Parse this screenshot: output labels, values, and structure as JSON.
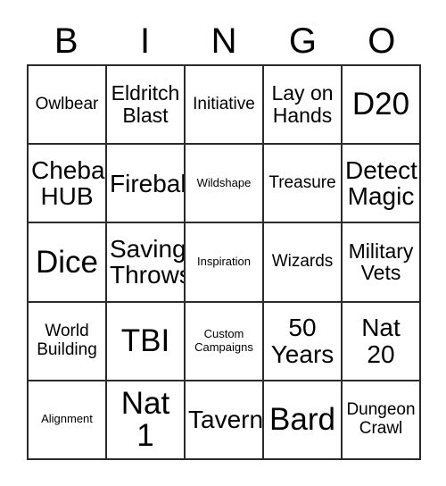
{
  "card": {
    "header_letters": [
      "B",
      "I",
      "N",
      "G",
      "O"
    ],
    "columns": 5,
    "rows": 5,
    "border_color": "#2b2b2b",
    "background_color": "#ffffff",
    "text_color": "#000000",
    "cells": [
      {
        "text": "Owlbear",
        "size": "md"
      },
      {
        "text": "Eldritch\nBlast",
        "size": "lg"
      },
      {
        "text": "Initiative",
        "size": "md"
      },
      {
        "text": "Lay on\nHands",
        "size": "lg"
      },
      {
        "text": "D20",
        "size": "xxl"
      },
      {
        "text": "Cheba\nHUB",
        "size": "xl"
      },
      {
        "text": "Fireball",
        "size": "xl"
      },
      {
        "text": "Wildshape",
        "size": "xs"
      },
      {
        "text": "Treasure",
        "size": "md"
      },
      {
        "text": "Detect\nMagic",
        "size": "xl"
      },
      {
        "text": "Dice",
        "size": "xxl"
      },
      {
        "text": "Saving\nThrows",
        "size": "xl"
      },
      {
        "text": "Inspiration",
        "size": "xs"
      },
      {
        "text": "Wizards",
        "size": "md"
      },
      {
        "text": "Military\nVets",
        "size": "lg"
      },
      {
        "text": "World\nBuilding",
        "size": "md"
      },
      {
        "text": "TBI",
        "size": "xxl"
      },
      {
        "text": "Custom\nCampaigns",
        "size": "xs"
      },
      {
        "text": "50\nYears",
        "size": "xl"
      },
      {
        "text": "Nat\n20",
        "size": "xl"
      },
      {
        "text": "Alignment",
        "size": "xs"
      },
      {
        "text": "Nat\n1",
        "size": "xxl"
      },
      {
        "text": "Tavern",
        "size": "xl"
      },
      {
        "text": "Bard",
        "size": "xxl"
      },
      {
        "text": "Dungeon\nCrawl",
        "size": "md"
      }
    ]
  }
}
